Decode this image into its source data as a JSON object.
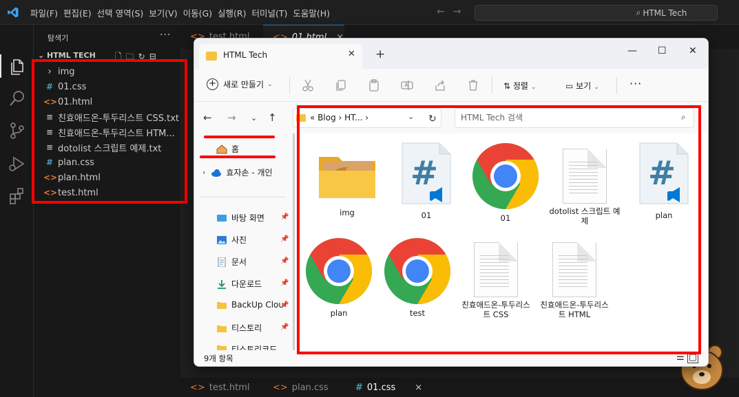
{
  "vscode": {
    "menu": [
      "파일(F)",
      "편집(E)",
      "선택 영역(S)",
      "보기(V)",
      "이동(G)",
      "실행(R)",
      "터미널(T)",
      "도움말(H)"
    ],
    "command_center": "HTML Tech",
    "explorer": {
      "title": "탐색기",
      "section": "HTML TECH",
      "items": [
        {
          "icon": "chevron-right-icon",
          "label": "img"
        },
        {
          "icon": "css-file-icon",
          "glyph": "#",
          "label": "01.css"
        },
        {
          "icon": "html-file-icon",
          "glyph": "<>",
          "label": "01.html"
        },
        {
          "icon": "text-file-icon",
          "glyph": "≡",
          "label": "친효애드온-투두리스트 CSS.txt"
        },
        {
          "icon": "text-file-icon",
          "glyph": "≡",
          "label": "친효애드온-투두리스트 HTM..."
        },
        {
          "icon": "text-file-icon",
          "glyph": "≡",
          "label": "dotolist 스크립트 예제.txt"
        },
        {
          "icon": "css-file-icon",
          "glyph": "#",
          "label": "plan.css"
        },
        {
          "icon": "html-file-icon",
          "glyph": "<>",
          "label": "plan.html"
        },
        {
          "icon": "html-file-icon",
          "glyph": "<>",
          "label": "test.html"
        }
      ]
    },
    "editor_tabs": [
      {
        "label": "test.html",
        "active": false
      },
      {
        "label": "01.html",
        "active": true,
        "close": "×"
      }
    ],
    "panel_tabs": [
      {
        "glyph": "<>",
        "label": "test.html"
      },
      {
        "glyph": "<>",
        "label": "plan.css"
      },
      {
        "glyph": "#",
        "label": "01.css",
        "close": "×"
      }
    ]
  },
  "explorer_window": {
    "tab_title": "HTML Tech",
    "toolbar": {
      "new_label": "새로 만들기",
      "sort_label": "정렬",
      "view_label": "보기"
    },
    "address": {
      "breadcrumb": "«  Blog  ›  HT...  ›"
    },
    "search_placeholder": "HTML Tech 검색",
    "navpane": {
      "home": "홈",
      "onedrive": "효자손 - 개인",
      "quick_access": [
        {
          "label": "바탕 화면",
          "icon": "desktop-icon"
        },
        {
          "label": "사진",
          "icon": "pictures-icon"
        },
        {
          "label": "문서",
          "icon": "documents-icon"
        },
        {
          "label": "다운로드",
          "icon": "downloads-icon"
        },
        {
          "label": "BackUp Clou",
          "icon": "folder-icon"
        },
        {
          "label": "티스토리",
          "icon": "folder-icon"
        },
        {
          "label": "티스토리코드",
          "icon": "folder-icon"
        }
      ]
    },
    "files": [
      {
        "label": "img",
        "kind": "folder"
      },
      {
        "label": "01",
        "kind": "css"
      },
      {
        "label": "01",
        "kind": "chrome"
      },
      {
        "label": "dotolist 스크립트 예제",
        "kind": "text"
      },
      {
        "label": "plan",
        "kind": "css"
      },
      {
        "label": "plan",
        "kind": "chrome"
      },
      {
        "label": "test",
        "kind": "chrome"
      },
      {
        "label": "친효애드온-투두리스트 CSS",
        "kind": "text"
      },
      {
        "label": "친효애드온-투두리스트 HTML",
        "kind": "text"
      }
    ],
    "status": "9개 항목"
  },
  "annotation_color": "#ff0000"
}
